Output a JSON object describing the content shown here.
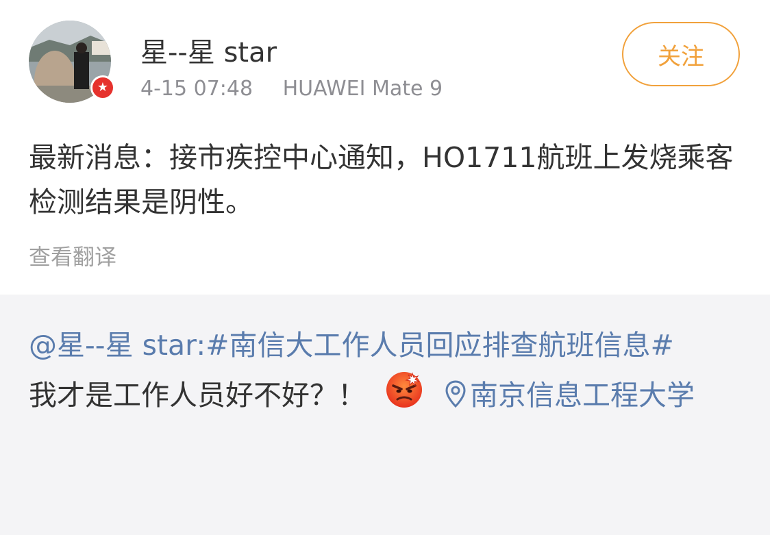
{
  "post": {
    "username": "星--星 star",
    "time": "4-15 07:48",
    "device": "HUAWEI Mate 9",
    "follow_label": "关注",
    "content": "最新消息：接市疾控中心通知，HO1711航班上发烧乘客检测结果是阴性。",
    "translate_label": "查看翻译"
  },
  "repost": {
    "mention": "@星--星 star:",
    "hashtag": "#南信大工作人员回应排查航班信息#",
    "text": "我才是工作人员好不好？！",
    "emoji": "angry-face-icon",
    "location": "南京信息工程大学"
  },
  "colors": {
    "link": "#5a7cad",
    "follow": "#f1a13b",
    "verified": "#e6322d",
    "repost_bg": "#f4f4f6"
  }
}
